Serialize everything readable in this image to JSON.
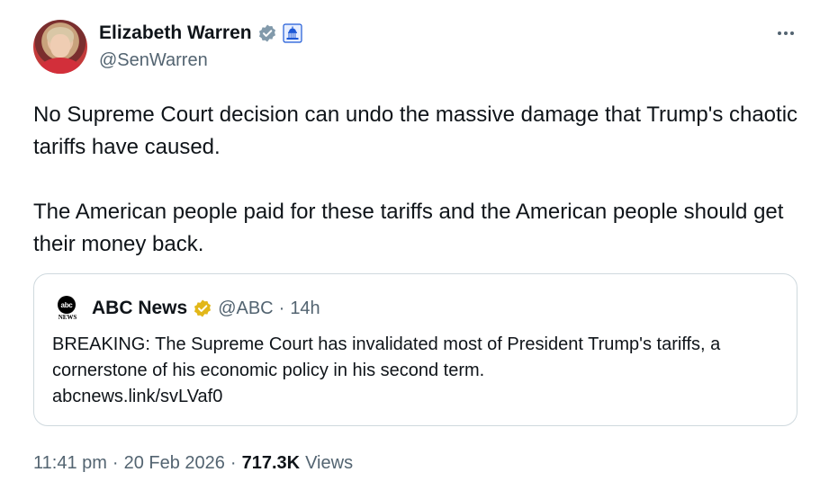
{
  "author": {
    "display_name": "Elizabeth Warren",
    "handle": "@SenWarren",
    "verified_icon": "verified-badge-icon",
    "affiliation_icon": "government-building-icon"
  },
  "tweet": {
    "text": "No Supreme Court decision can undo the massive damage that Trump's chaotic tariffs have caused.\n\nThe American people paid for these tariffs and the American people should get their money back."
  },
  "quoted_tweet": {
    "logo_text": "abc",
    "logo_subtext": "NEWS",
    "display_name": "ABC News",
    "handle": "@ABC",
    "separator": "·",
    "age": "14h",
    "text": "BREAKING: The Supreme Court has invalidated most of President Trump's tariffs, a cornerstone of his economic policy in his second term.",
    "link": "abcnews.link/svLVaf0"
  },
  "footer": {
    "time": "11:41 pm",
    "dot1": "·",
    "date": "20 Feb 2026",
    "dot2": "·",
    "views_count": "717.3K",
    "views_label": "Views"
  },
  "colors": {
    "text_primary": "#0f1419",
    "text_secondary": "#536471",
    "border": "#cfd9de",
    "verified_grey": "#829aab",
    "verified_gold": "#e2b719",
    "gov_icon_blue": "#1d59d6"
  }
}
